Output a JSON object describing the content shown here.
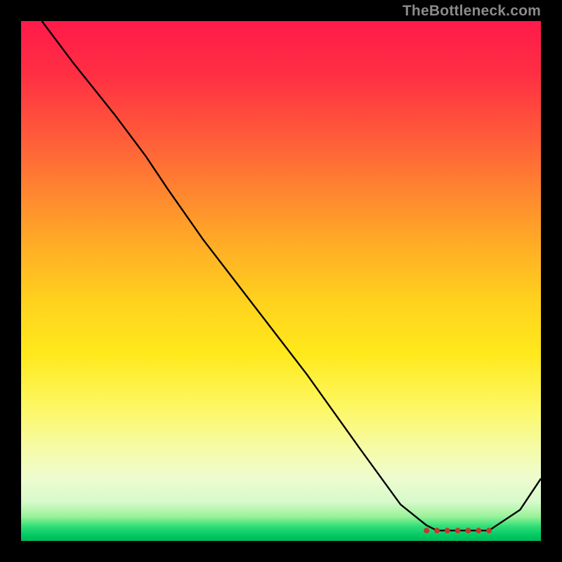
{
  "watermark": "TheBottleneck.com",
  "chart_data": {
    "type": "line",
    "title": "",
    "xlabel": "",
    "ylabel": "",
    "xlim": [
      0,
      100
    ],
    "ylim": [
      0,
      100
    ],
    "grid": false,
    "legend": false,
    "x": [
      4,
      10,
      18,
      24,
      28,
      35,
      45,
      55,
      65,
      73,
      78,
      80,
      82,
      84,
      86,
      88,
      90,
      96,
      100
    ],
    "values": [
      100,
      92,
      82,
      74,
      68,
      58,
      45,
      32,
      18,
      7,
      3,
      2,
      2,
      2,
      2,
      2,
      2,
      6,
      12
    ],
    "markers_x": [
      78,
      80,
      82,
      84,
      86,
      88,
      90
    ],
    "markers_y": [
      2,
      2,
      2,
      2,
      2,
      2,
      2
    ],
    "annotations": []
  },
  "colors": {
    "curve": "#000000",
    "marker": "#c0392b",
    "watermark": "#8a8a8a",
    "frame": "#000000"
  }
}
